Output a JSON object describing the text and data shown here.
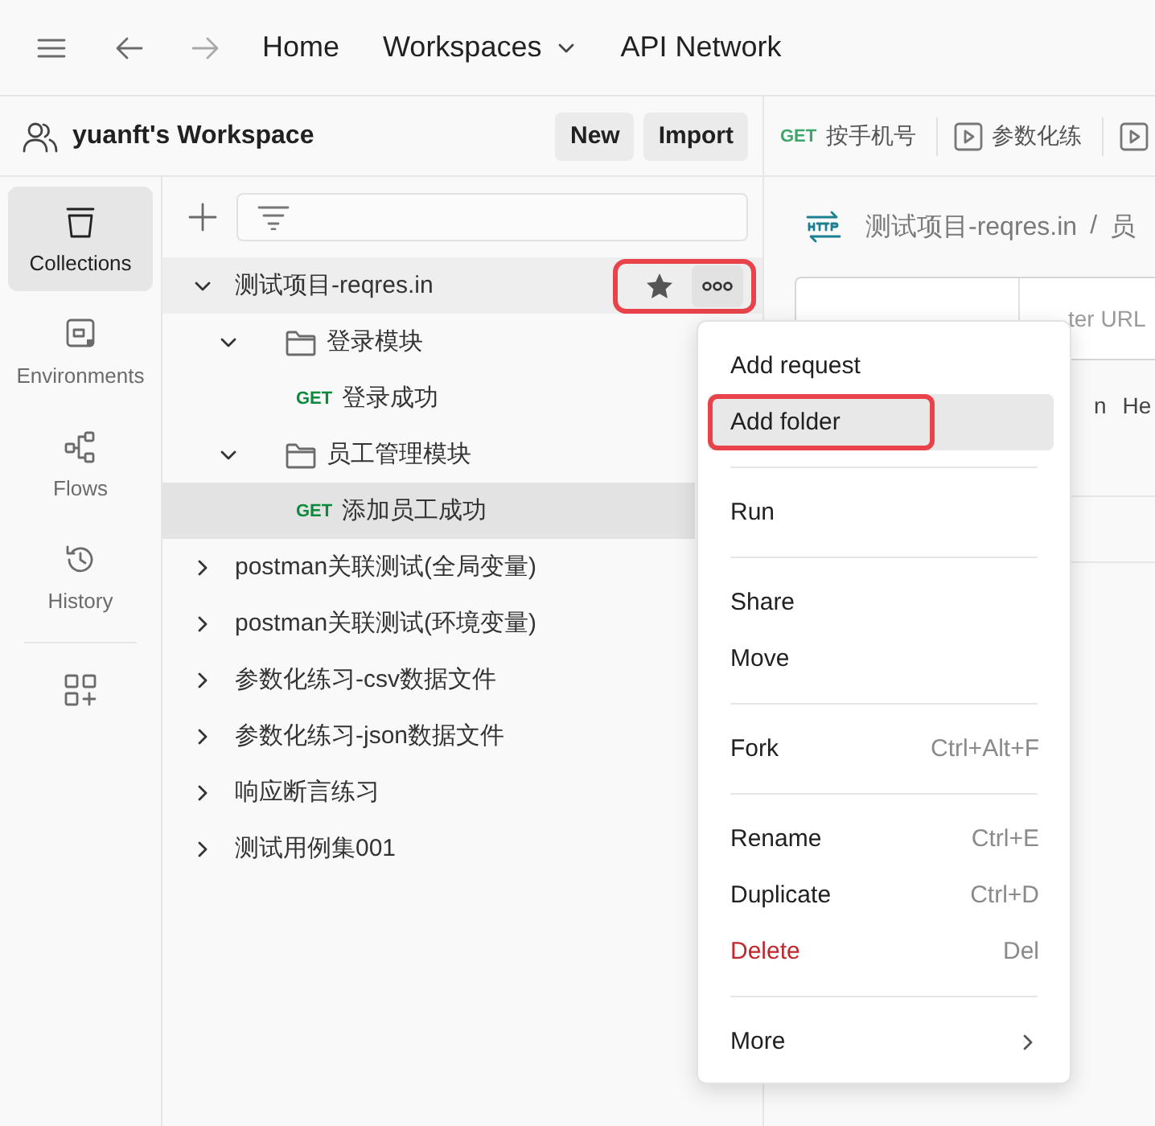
{
  "top_bar": {
    "forward_disabled": true,
    "nav": [
      {
        "label": "Home",
        "dropdown": false
      },
      {
        "label": "Workspaces",
        "dropdown": true
      },
      {
        "label": "API Network",
        "dropdown": false
      }
    ]
  },
  "workspace": {
    "name": "yuanft's Workspace",
    "buttons": [
      "New",
      "Import"
    ]
  },
  "sidebar": {
    "items": [
      {
        "label": "Collections",
        "selected": true
      },
      {
        "label": "Environments",
        "selected": false
      },
      {
        "label": "Flows",
        "selected": false
      },
      {
        "label": "History",
        "selected": false
      }
    ]
  },
  "tree": [
    {
      "kind": "collection",
      "label": "测试项目-reqres.in",
      "expanded": true,
      "hovered": true,
      "highlighted": true,
      "selected": false,
      "children": [
        {
          "kind": "folder",
          "label": "登录模块",
          "expanded": true,
          "selected": false,
          "children": [
            {
              "kind": "request",
              "method": "GET",
              "label": "登录成功",
              "selected": false
            }
          ]
        },
        {
          "kind": "folder",
          "label": "员工管理模块",
          "expanded": true,
          "selected": false,
          "children": [
            {
              "kind": "request",
              "method": "GET",
              "label": "添加员工成功",
              "selected": true
            }
          ]
        }
      ]
    },
    {
      "kind": "collection",
      "label": "postman关联测试(全局变量)",
      "expanded": false,
      "hovered": false,
      "selected": false
    },
    {
      "kind": "collection",
      "label": "postman关联测试(环境变量)",
      "expanded": false,
      "hovered": false,
      "selected": false
    },
    {
      "kind": "collection",
      "label": "参数化练习-csv数据文件",
      "expanded": false,
      "hovered": false,
      "selected": false
    },
    {
      "kind": "collection",
      "label": "参数化练习-json数据文件",
      "expanded": false,
      "hovered": false,
      "selected": false
    },
    {
      "kind": "collection",
      "label": "响应断言练习",
      "expanded": false,
      "hovered": false,
      "selected": false
    },
    {
      "kind": "collection",
      "label": "测试用例集001",
      "expanded": false,
      "hovered": false,
      "selected": false
    }
  ],
  "tabs": [
    {
      "kind": "request",
      "method": "GET",
      "label": "按手机号"
    },
    {
      "kind": "runner",
      "label": "参数化练"
    },
    {
      "kind": "runner"
    }
  ],
  "breadcrumb": {
    "parts": [
      "测试项目-reqres.in",
      "员"
    ],
    "separator": "/"
  },
  "url_field": {
    "placeholder": "ter URL"
  },
  "request_tabs": [
    "n",
    "He"
  ],
  "context_menu": {
    "items": [
      {
        "kind": "item",
        "label": "Add request",
        "selected": false,
        "highlighted": false
      },
      {
        "kind": "item",
        "label": "Add folder",
        "selected": true,
        "highlighted": true
      },
      {
        "kind": "divider"
      },
      {
        "kind": "item",
        "label": "Run",
        "selected": false,
        "highlighted": false
      },
      {
        "kind": "divider"
      },
      {
        "kind": "item",
        "label": "Share",
        "selected": false,
        "highlighted": false
      },
      {
        "kind": "item",
        "label": "Move",
        "selected": false,
        "highlighted": false
      },
      {
        "kind": "divider"
      },
      {
        "kind": "item",
        "label": "Fork",
        "shortcut": "Ctrl+Alt+F",
        "selected": false,
        "highlighted": false
      },
      {
        "kind": "divider"
      },
      {
        "kind": "item",
        "label": "Rename",
        "shortcut": "Ctrl+E",
        "selected": false,
        "highlighted": false
      },
      {
        "kind": "item",
        "label": "Duplicate",
        "shortcut": "Ctrl+D",
        "selected": false,
        "highlighted": false
      },
      {
        "kind": "item",
        "label": "Delete",
        "shortcut": "Del",
        "danger": true,
        "selected": false,
        "highlighted": false
      },
      {
        "kind": "divider"
      },
      {
        "kind": "item",
        "label": "More",
        "submenu": true,
        "selected": false,
        "highlighted": false
      }
    ]
  }
}
